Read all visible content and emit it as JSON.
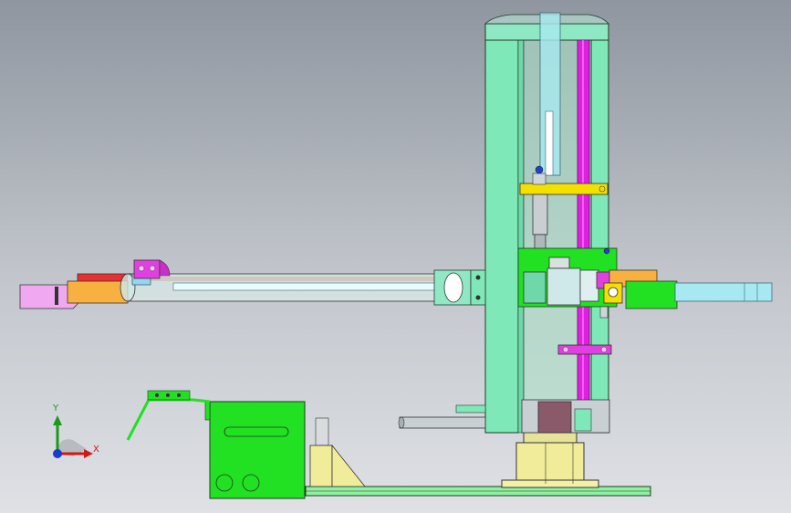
{
  "triad": {
    "y_label": "Y",
    "x_label": "X",
    "colors": {
      "x": "#d01818",
      "y": "#1a9a1a",
      "z": "#1a3ad0"
    }
  },
  "model_colors": {
    "frame_green": "#7fe8b8",
    "plate_green": "#8ff0a0",
    "bright_green": "#22e022",
    "magenta": "#e020e0",
    "yellow": "#f4e000",
    "cream": "#f0ec9a",
    "pink": "#f0a8f0",
    "orange": "#f8b040",
    "red": "#e83030",
    "cyan_pipe": "#a8e8f0",
    "steel": "#bfc7cc"
  }
}
